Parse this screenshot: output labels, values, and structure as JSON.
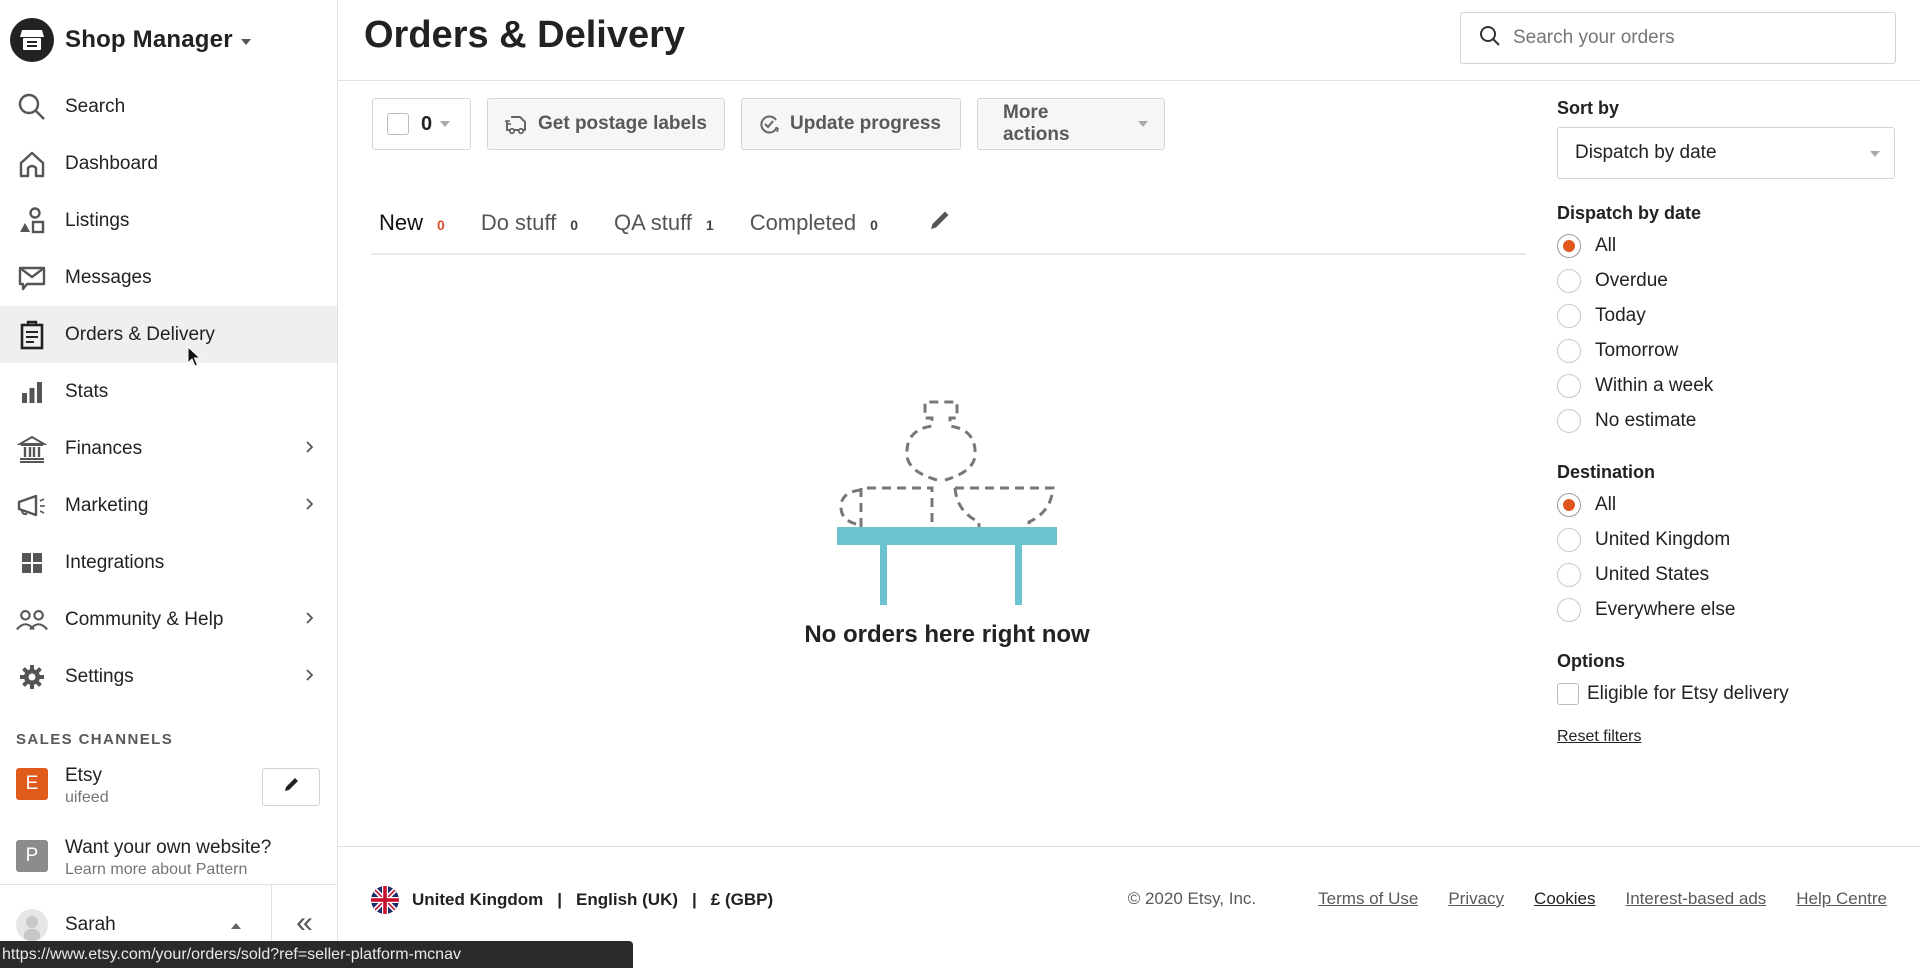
{
  "app": {
    "title": "Shop Manager"
  },
  "sidebar": {
    "items": [
      {
        "label": "Search",
        "icon": "search-icon",
        "has_submenu": false
      },
      {
        "label": "Dashboard",
        "icon": "home-icon",
        "has_submenu": false
      },
      {
        "label": "Listings",
        "icon": "shapes-icon",
        "has_submenu": false
      },
      {
        "label": "Messages",
        "icon": "envelope-icon",
        "has_submenu": false
      },
      {
        "label": "Orders & Delivery",
        "icon": "clipboard-icon",
        "has_submenu": false,
        "active": true
      },
      {
        "label": "Stats",
        "icon": "bar-chart-icon",
        "has_submenu": false
      },
      {
        "label": "Finances",
        "icon": "bank-icon",
        "has_submenu": true
      },
      {
        "label": "Marketing",
        "icon": "megaphone-icon",
        "has_submenu": true
      },
      {
        "label": "Integrations",
        "icon": "grid-icon",
        "has_submenu": false
      },
      {
        "label": "Community & Help",
        "icon": "people-icon",
        "has_submenu": true
      },
      {
        "label": "Settings",
        "icon": "gear-icon",
        "has_submenu": true
      }
    ],
    "sales_channels_title": "SALES CHANNELS",
    "channels": [
      {
        "badge": "E",
        "name": "Etsy",
        "sub": "uifeed",
        "color": "#e05a1c"
      },
      {
        "badge": "P",
        "name": "Want your own website?",
        "sub": "Learn more about Pattern",
        "color": "#8c8c8c"
      }
    ],
    "user": {
      "name": "Sarah"
    },
    "collapse_glyph": "«"
  },
  "status_bar": {
    "url": "https://www.etsy.com/your/orders/sold?ref=seller-platform-mcnav"
  },
  "header": {
    "title": "Orders & Delivery",
    "search_placeholder": "Search your orders",
    "search_value": ""
  },
  "toolbar": {
    "selected_count": "0",
    "postage_label": "Get postage labels",
    "progress_label": "Update progress",
    "more_label": "More actions"
  },
  "tabs": [
    {
      "label": "New",
      "count": "0",
      "active": true
    },
    {
      "label": "Do stuff",
      "count": "0"
    },
    {
      "label": "QA stuff",
      "count": "1"
    },
    {
      "label": "Completed",
      "count": "0"
    }
  ],
  "empty_state": {
    "message": "No orders here right now"
  },
  "filters": {
    "sort_title": "Sort by",
    "sort_value": "Dispatch by date",
    "dispatch": {
      "title": "Dispatch by date",
      "options": [
        "All",
        "Overdue",
        "Today",
        "Tomorrow",
        "Within a week",
        "No estimate"
      ],
      "selected": "All"
    },
    "destination": {
      "title": "Destination",
      "options": [
        "All",
        "United Kingdom",
        "United States",
        "Everywhere else"
      ],
      "selected": "All"
    },
    "options": {
      "title": "Options",
      "checkbox_label": "Eligible for Etsy delivery",
      "checked": false
    },
    "reset_label": "Reset filters"
  },
  "footer": {
    "region": "United Kingdom",
    "language": "English (UK)",
    "currency": "£ (GBP)",
    "separator": "|",
    "copyright": "© 2020 Etsy, Inc.",
    "links": [
      "Terms of Use",
      "Privacy",
      "Cookies",
      "Interest-based ads",
      "Help Centre"
    ]
  },
  "colors": {
    "accent": "#e0571b",
    "tab_count_active": "#d5512b",
    "table_illustration": "#6cc3cf",
    "sidebar_active_bg": "#efefef"
  }
}
